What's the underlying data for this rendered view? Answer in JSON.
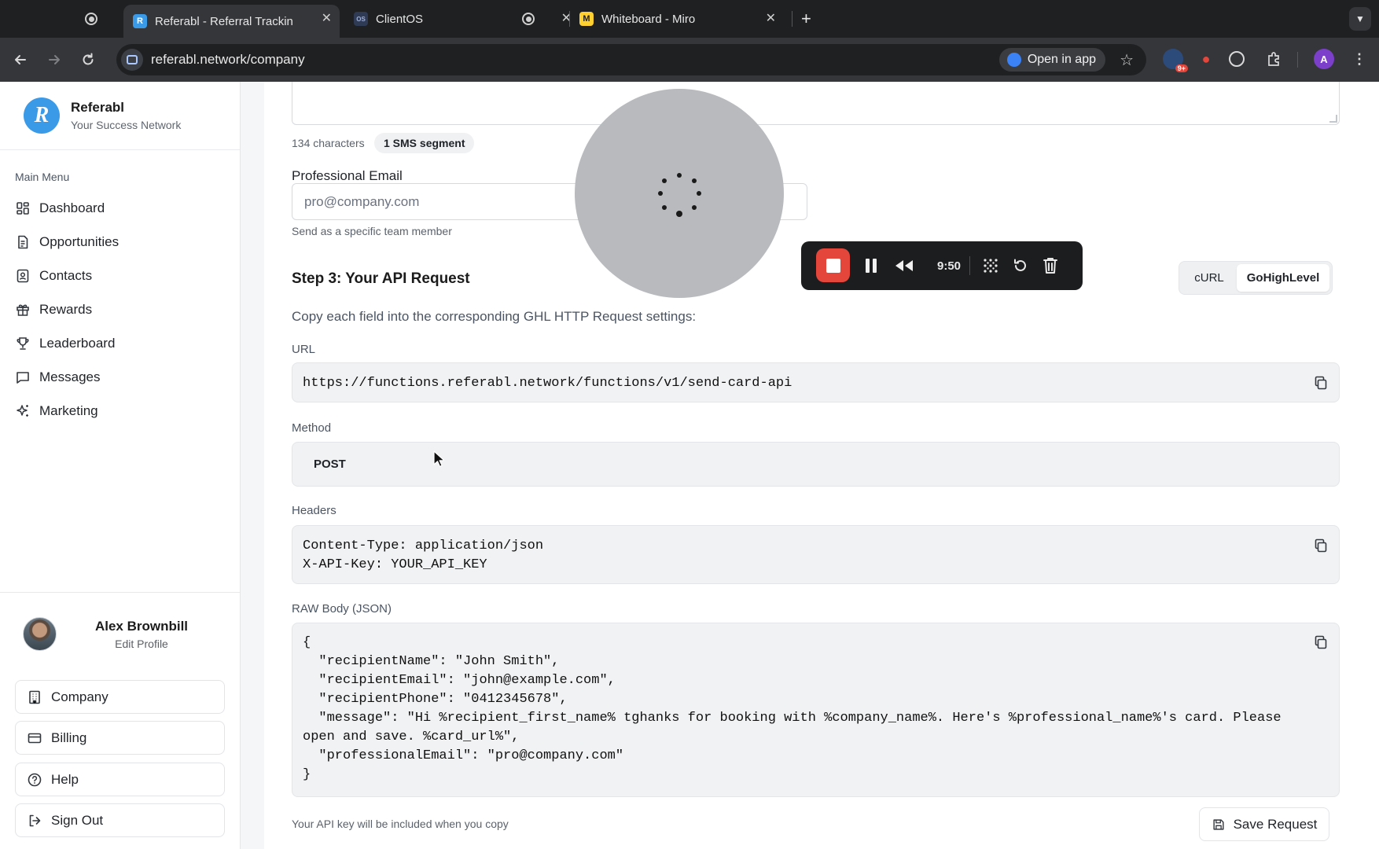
{
  "browser": {
    "tabs": [
      {
        "title": "",
        "icon": "record-icon"
      },
      {
        "title": "Referabl - Referral Trackin",
        "icon": "referabl-icon",
        "active": true
      },
      {
        "title": "ClientOS",
        "icon": "clientos-icon"
      },
      {
        "title": "Whiteboard - Miro",
        "icon": "miro-icon"
      }
    ],
    "url": "referabl.network/company",
    "open_in_app": "Open in app",
    "ext_badge": "9+",
    "profile_initial": "A"
  },
  "sidebar": {
    "brand_name": "Referabl",
    "brand_tagline": "Your Success Network",
    "menu_heading": "Main Menu",
    "items": [
      {
        "label": "Dashboard",
        "icon": "dashboard-icon"
      },
      {
        "label": "Opportunities",
        "icon": "document-icon"
      },
      {
        "label": "Contacts",
        "icon": "contact-icon"
      },
      {
        "label": "Rewards",
        "icon": "gift-icon"
      },
      {
        "label": "Leaderboard",
        "icon": "trophy-icon"
      },
      {
        "label": "Messages",
        "icon": "message-icon"
      },
      {
        "label": "Marketing",
        "icon": "sparkle-icon"
      }
    ],
    "user": {
      "name": "Alex Brownbill",
      "edit": "Edit Profile"
    },
    "buttons": [
      {
        "label": "Company",
        "icon": "building-icon"
      },
      {
        "label": "Billing",
        "icon": "credit-card-icon"
      },
      {
        "label": "Help",
        "icon": "help-icon"
      },
      {
        "label": "Sign Out",
        "icon": "sign-out-icon"
      }
    ]
  },
  "main": {
    "char_count": "134 characters",
    "sms_segment": "1 SMS segment",
    "professional_email_label": "Professional Email",
    "professional_email_placeholder": "pro@company.com",
    "professional_email_hint": "Send as a specific team member",
    "step3_title": "Step 3: Your API Request",
    "format_tabs": [
      "cURL",
      "GoHighLevel"
    ],
    "active_format": "GoHighLevel",
    "instructions": "Copy each field into the corresponding GHL HTTP Request settings:",
    "url_label": "URL",
    "url_value": "https://functions.referabl.network/functions/v1/send-card-api",
    "method_label": "Method",
    "method_value": "POST",
    "headers_label": "Headers",
    "headers_value": "Content-Type: application/json\nX-API-Key: YOUR_API_KEY",
    "body_label": "RAW Body (JSON)",
    "body_value": "{\n  \"recipientName\": \"John Smith\",\n  \"recipientEmail\": \"john@example.com\",\n  \"recipientPhone\": \"0412345678\",\n  \"message\": \"Hi %recipient_first_name% tghanks for booking with %company_name%. Here's %professional_name%'s card. Please open and save. %card_url%\",\n  \"professionalEmail\": \"pro@company.com\"\n}",
    "api_note": "Your API key will be included when you copy",
    "save_label": "Save Request"
  },
  "recorder": {
    "time": "9:50"
  },
  "colors": {
    "accent": "#3b9ae8",
    "record_red": "#e5463b"
  }
}
